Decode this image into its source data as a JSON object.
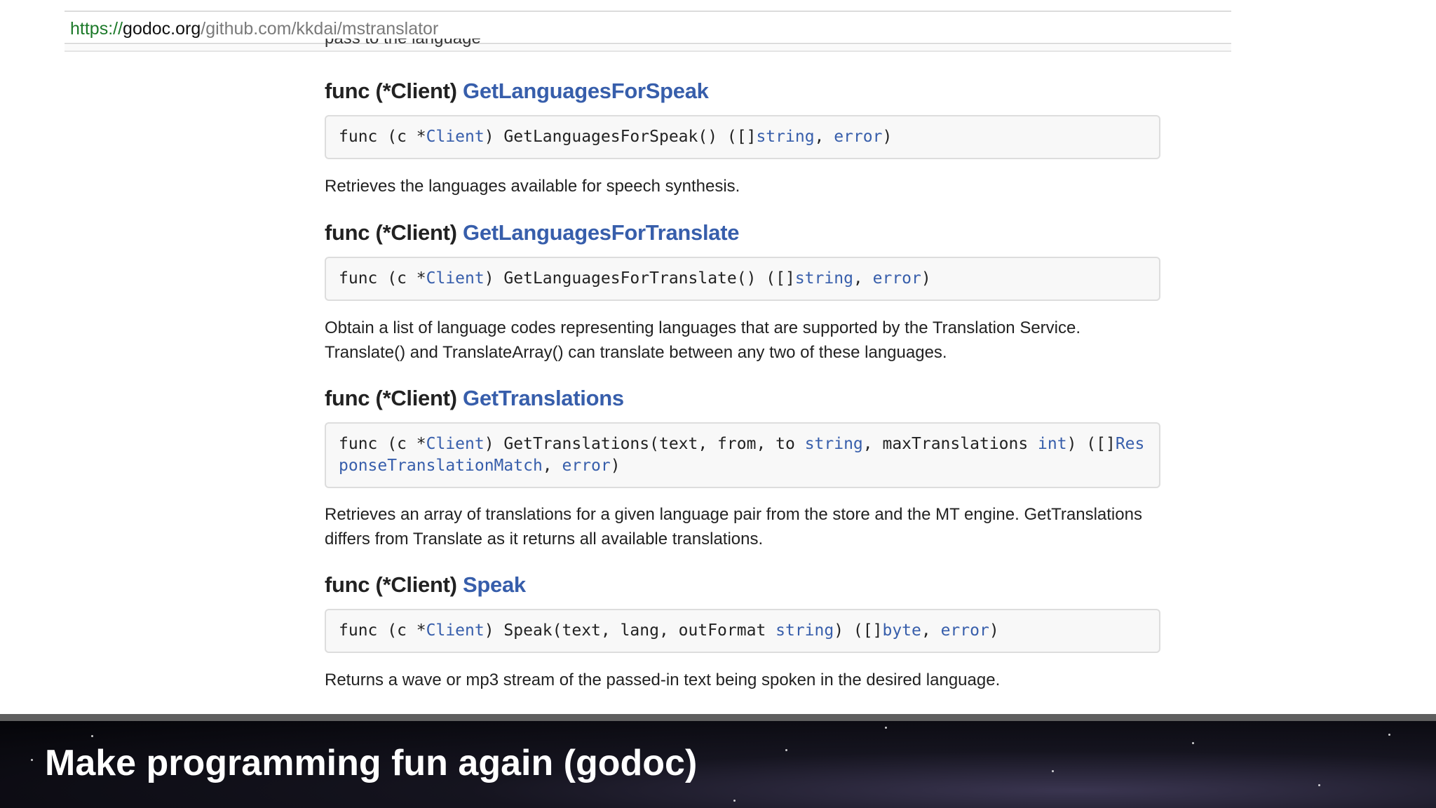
{
  "browser": {
    "url_scheme": "https://",
    "url_host": "godoc.org",
    "url_path": "/github.com/kkdai/mstranslator"
  },
  "clipped_top_text": "pass to the language",
  "functions": [
    {
      "heading_prefix": "func (*Client) ",
      "name": "GetLanguagesForSpeak",
      "code": [
        {
          "t": "func (c *",
          "c": "plain"
        },
        {
          "t": "Client",
          "c": "type"
        },
        {
          "t": ") GetLanguagesForSpeak() ([]",
          "c": "plain"
        },
        {
          "t": "string",
          "c": "type"
        },
        {
          "t": ", ",
          "c": "plain"
        },
        {
          "t": "error",
          "c": "type"
        },
        {
          "t": ")",
          "c": "plain"
        }
      ],
      "description": "Retrieves the languages available for speech synthesis."
    },
    {
      "heading_prefix": "func (*Client) ",
      "name": "GetLanguagesForTranslate",
      "code": [
        {
          "t": "func (c *",
          "c": "plain"
        },
        {
          "t": "Client",
          "c": "type"
        },
        {
          "t": ") GetLanguagesForTranslate() ([]",
          "c": "plain"
        },
        {
          "t": "string",
          "c": "type"
        },
        {
          "t": ", ",
          "c": "plain"
        },
        {
          "t": "error",
          "c": "type"
        },
        {
          "t": ")",
          "c": "plain"
        }
      ],
      "description": "Obtain a list of language codes representing languages that are supported by the Translation Service. Translate() and TranslateArray() can translate between any two of these languages."
    },
    {
      "heading_prefix": "func (*Client) ",
      "name": "GetTranslations",
      "code": [
        {
          "t": "func (c *",
          "c": "plain"
        },
        {
          "t": "Client",
          "c": "type"
        },
        {
          "t": ") GetTranslations(text, from, to ",
          "c": "plain"
        },
        {
          "t": "string",
          "c": "type"
        },
        {
          "t": ", maxTranslations ",
          "c": "plain"
        },
        {
          "t": "int",
          "c": "type"
        },
        {
          "t": ") ([]",
          "c": "plain"
        },
        {
          "t": "ResponseTranslationMatch",
          "c": "type"
        },
        {
          "t": ", ",
          "c": "plain"
        },
        {
          "t": "error",
          "c": "type"
        },
        {
          "t": ")",
          "c": "plain"
        }
      ],
      "description": "Retrieves an array of translations for a given language pair from the store and the MT engine. GetTranslations differs from Translate as it returns all available translations."
    },
    {
      "heading_prefix": "func (*Client) ",
      "name": "Speak",
      "code": [
        {
          "t": "func (c *",
          "c": "plain"
        },
        {
          "t": "Client",
          "c": "type"
        },
        {
          "t": ") Speak(text, lang, outFormat ",
          "c": "plain"
        },
        {
          "t": "string",
          "c": "type"
        },
        {
          "t": ") ([]",
          "c": "plain"
        },
        {
          "t": "byte",
          "c": "type"
        },
        {
          "t": ", ",
          "c": "plain"
        },
        {
          "t": "error",
          "c": "type"
        },
        {
          "t": ")",
          "c": "plain"
        }
      ],
      "description": "Returns a wave or mp3 stream of the passed-in text being spoken in the desired language."
    }
  ],
  "slide": {
    "title": "Make programming fun again (godoc)"
  },
  "colors": {
    "link": "#375eab",
    "scheme_green": "#1d7a2a"
  }
}
